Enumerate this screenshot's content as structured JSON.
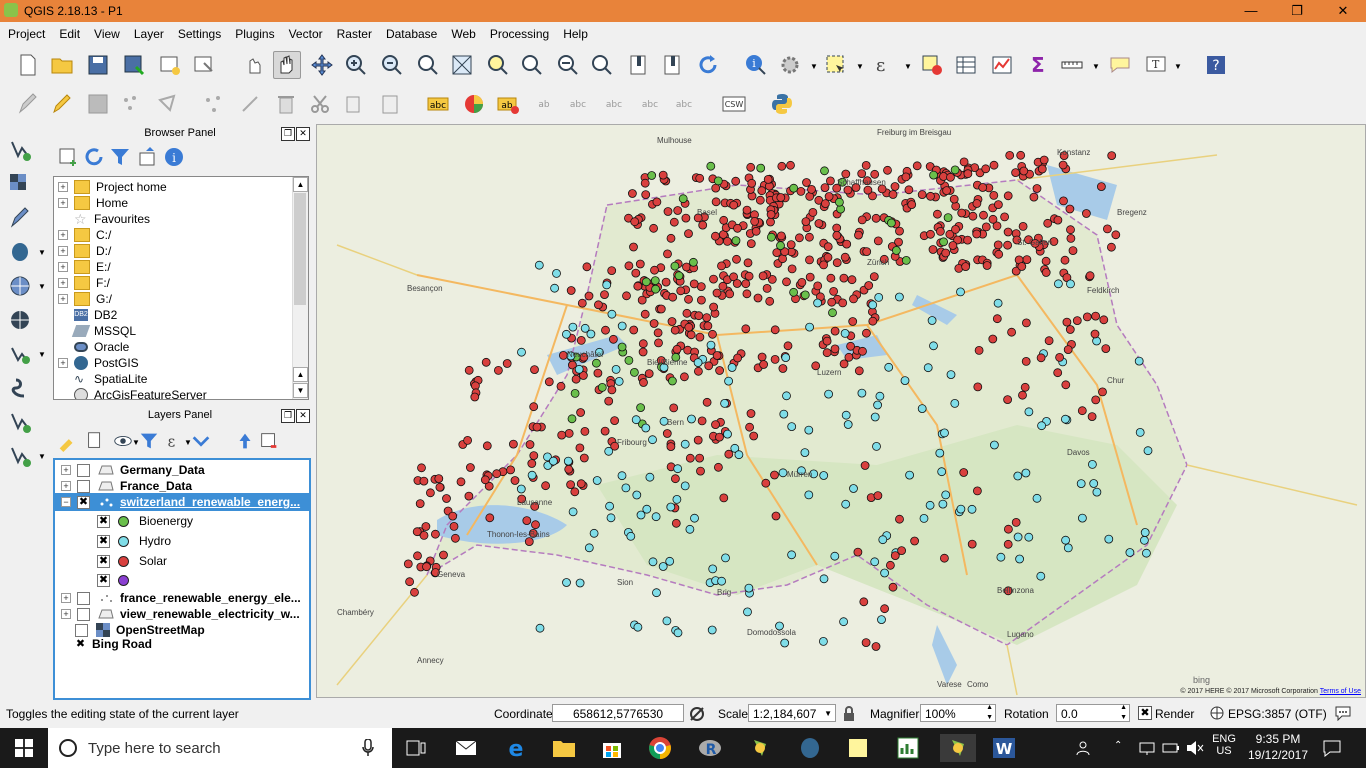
{
  "window": {
    "title": "QGIS 2.18.13 - P1",
    "controls": [
      "minimize",
      "restore",
      "close"
    ]
  },
  "menu": [
    "Project",
    "Edit",
    "View",
    "Layer",
    "Settings",
    "Plugins",
    "Vector",
    "Raster",
    "Database",
    "Web",
    "Processing",
    "Help"
  ],
  "browser_panel": {
    "title": "Browser Panel",
    "items": [
      {
        "label": "Project home",
        "icon": "folder-icon"
      },
      {
        "label": "Home",
        "icon": "folder-icon"
      },
      {
        "label": "Favourites",
        "icon": "star-icon"
      },
      {
        "label": "C:/",
        "icon": "folder-icon"
      },
      {
        "label": "D:/",
        "icon": "folder-icon"
      },
      {
        "label": "E:/",
        "icon": "folder-icon"
      },
      {
        "label": "F:/",
        "icon": "folder-icon"
      },
      {
        "label": "G:/",
        "icon": "folder-icon"
      },
      {
        "label": "DB2",
        "icon": "db2-icon"
      },
      {
        "label": "MSSQL",
        "icon": "mssql-icon"
      },
      {
        "label": "Oracle",
        "icon": "oracle-icon"
      },
      {
        "label": "PostGIS",
        "icon": "postgis-icon"
      },
      {
        "label": "SpatiaLite",
        "icon": "spatialite-icon"
      },
      {
        "label": "ArcGisFeatureServer",
        "icon": "arcgis-icon"
      }
    ]
  },
  "layers_panel": {
    "title": "Layers Panel",
    "layers": [
      {
        "label": "Germany_Data",
        "checked": false,
        "bold": true
      },
      {
        "label": "France_Data",
        "checked": false,
        "bold": true
      },
      {
        "label": "switzerland_renewable_energ...",
        "checked": true,
        "bold": true,
        "selected": true
      },
      {
        "label": "france_renewable_energy_ele...",
        "checked": false,
        "bold": true
      },
      {
        "label": "view_renewable_electricity_w...",
        "checked": false,
        "bold": true
      },
      {
        "label": "OpenStreetMap",
        "checked": false,
        "bold": true
      },
      {
        "label": "Bing Road",
        "checked": true,
        "bold": true
      }
    ],
    "legend": [
      {
        "label": "Bioenergy",
        "color": "#6abf4b"
      },
      {
        "label": "Hydro",
        "color": "#7fdde8"
      },
      {
        "label": "Solar",
        "color": "#d9403e"
      },
      {
        "label": "",
        "color": "#8a3fd1"
      }
    ]
  },
  "map": {
    "place_labels": [
      "Besançon",
      "Mulhouse",
      "Freiburg im Breisgau",
      "Konstanz",
      "Bregenz",
      "Feldkirch",
      "Chur",
      "Lugano",
      "Como",
      "Varese",
      "Bellinzona",
      "Geneva",
      "Annecy",
      "Thonon-les-Bains",
      "Lausanne",
      "Neuchâtel",
      "Bern",
      "Luzern",
      "Zürich",
      "St. Gallen",
      "Schaffhausen",
      "Basel",
      "Biel/Bienne",
      "Fribourg",
      "Sion",
      "Brig",
      "Domodossola",
      "Davos",
      "Mürren",
      "Chambéry"
    ],
    "copyright": "© 2017 HERE © 2017 Microsoft Corporation",
    "terms": "Terms of Use",
    "bing": "bing"
  },
  "status": {
    "hint": "Toggles the editing state of the current layer",
    "coordinate_label": "Coordinate",
    "coordinate_value": "658612,5776530",
    "scale_label": "Scale",
    "scale_value": "1:2,184,607",
    "magnifier_label": "Magnifier",
    "magnifier_value": "100%",
    "rotation_label": "Rotation",
    "rotation_value": "0.0",
    "render_label": "Render",
    "render_checked": true,
    "crs": "EPSG:3857 (OTF)"
  },
  "taskbar": {
    "search_placeholder": "Type here to search",
    "language": "ENG",
    "region": "US",
    "time": "9:35 PM",
    "date": "19/12/2017"
  },
  "colors": {
    "titlebar": "#e8833a",
    "selection": "#3d8fd6",
    "solar": "#d9403e",
    "hydro": "#7fdde8",
    "bioenergy": "#6abf4b"
  }
}
